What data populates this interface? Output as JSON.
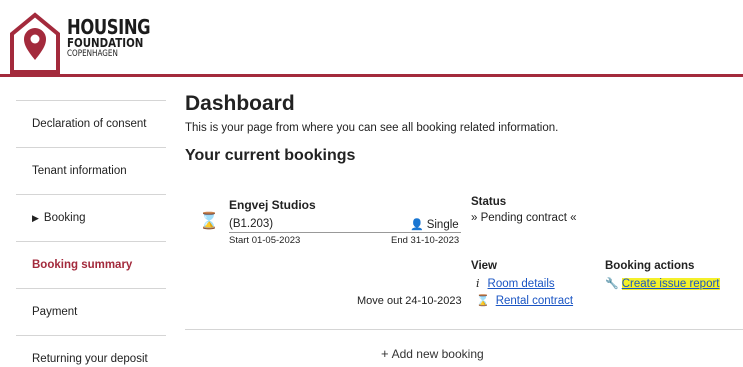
{
  "brand": {
    "line1": "HOUSING",
    "line2": "FOUNDATION",
    "line3": "COPENHAGEN",
    "color": "#a32a3c"
  },
  "sidebar": {
    "items": [
      {
        "label": "Declaration of consent",
        "active": false
      },
      {
        "label": "Tenant information",
        "active": false
      },
      {
        "label": "Booking",
        "active": false,
        "icon": "triangle-right-icon"
      },
      {
        "label": "Booking summary",
        "active": true
      },
      {
        "label": "Payment",
        "active": false
      },
      {
        "label": "Returning your deposit",
        "active": false
      }
    ]
  },
  "main": {
    "title": "Dashboard",
    "subtitle": "This is your page from where you can see all booking related information.",
    "bookings_title": "Your current bookings",
    "booking": {
      "name": "Engvej Studios",
      "code": "(B1.203)",
      "type": "Single",
      "start": "Start 01-05-2023",
      "end": "End 31-10-2023",
      "move_out": "Move out 24-10-2023",
      "status_label": "Status",
      "status_value": "» Pending contract «",
      "view_label": "View",
      "room_details": "Room details",
      "rental_contract": "Rental contract",
      "actions_label": "Booking actions",
      "create_issue": "Create issue report"
    },
    "add_booking": "Add new booking"
  },
  "colors": {
    "accent": "#a32a3c",
    "link": "#1a55c4",
    "highlight": "#f4f02a"
  }
}
